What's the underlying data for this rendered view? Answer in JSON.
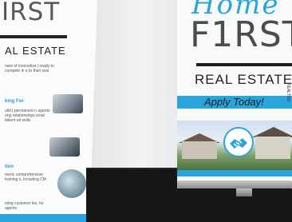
{
  "left_banner": {
    "brand": "IRST",
    "subtitle": "AL ESTATE",
    "para1": "nare of innovative | ready to compete in e to their real",
    "heading1": "king For",
    "para2": "ulld | permanent n agents ong relationships ional tollent ed skills",
    "heading2": "tion",
    "para3": "ment, comprehensive training s, including CM",
    "para4": "sting customer les, for agents"
  },
  "right_banner": {
    "script_text": "Home",
    "brand": "F1RST",
    "subtitle": "REAL ESTATE",
    "cta": "Apply Today!",
    "side_tag": "REALTOR"
  },
  "colors": {
    "accent": "#2aa4dc",
    "dark": "#161616",
    "text": "#4a4c4f"
  },
  "icons": {
    "handshake": "handshake-icon"
  }
}
